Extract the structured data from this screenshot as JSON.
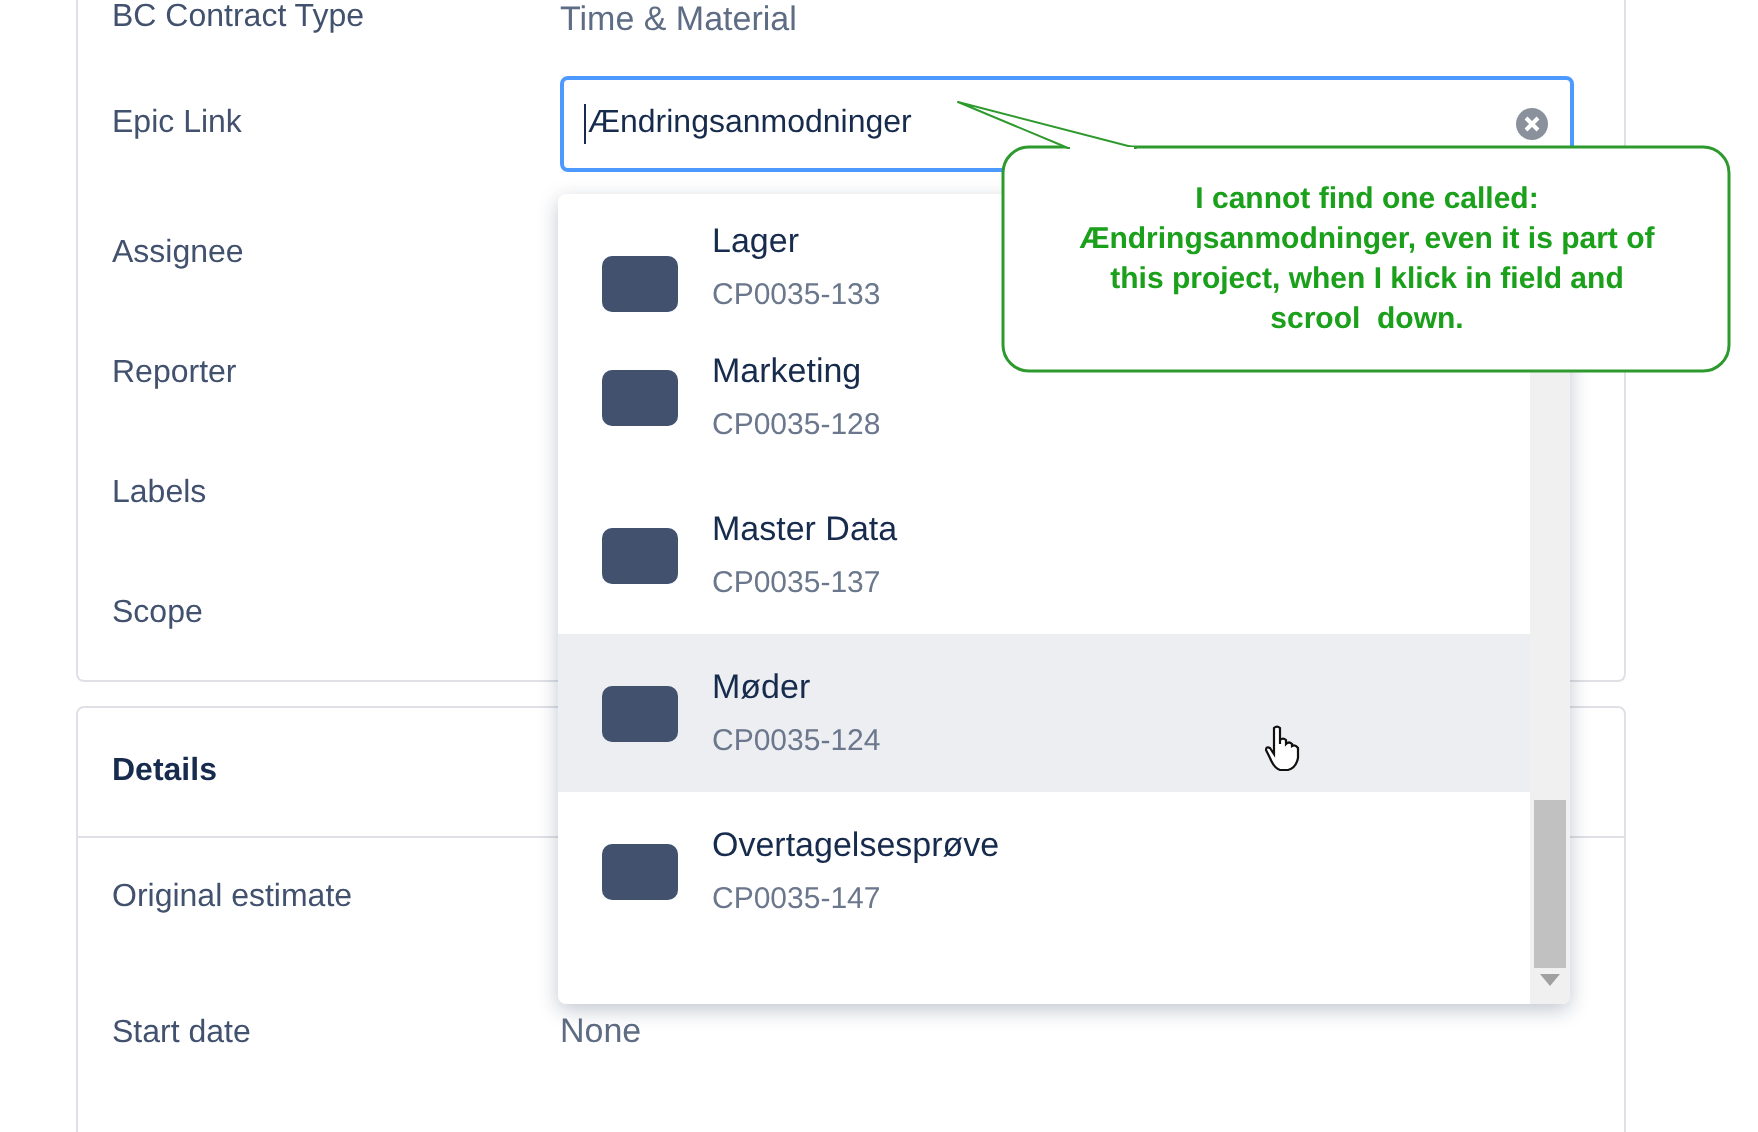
{
  "fields_card": {
    "rows": [
      {
        "label": "BC Contract Type",
        "value": "Time & Material"
      },
      {
        "label": "Epic Link",
        "kind": "input"
      },
      {
        "label": "Assignee"
      },
      {
        "label": "Reporter"
      },
      {
        "label": "Labels"
      },
      {
        "label": "Scope"
      }
    ]
  },
  "epic_input": {
    "value": "Ændringsanmodninger"
  },
  "dropdown": {
    "items": [
      {
        "name": "Lager",
        "key": "CP0035-133",
        "highlighted": false
      },
      {
        "name": "Marketing",
        "key": "CP0035-128",
        "highlighted": false
      },
      {
        "name": "Master Data",
        "key": "CP0035-137",
        "highlighted": false
      },
      {
        "name": "Møder",
        "key": "CP0035-124",
        "highlighted": true
      },
      {
        "name": "Overtagelsesprøve",
        "key": "CP0035-147",
        "highlighted": false
      }
    ]
  },
  "callout": {
    "text": "I cannot find one called: Ændringsanmodninger, even it is part of this project, when I klick in field and scrool  down."
  },
  "details_card": {
    "title": "Details",
    "rows": [
      {
        "label": "Original estimate"
      },
      {
        "label": "Start date",
        "value": "None"
      }
    ]
  }
}
